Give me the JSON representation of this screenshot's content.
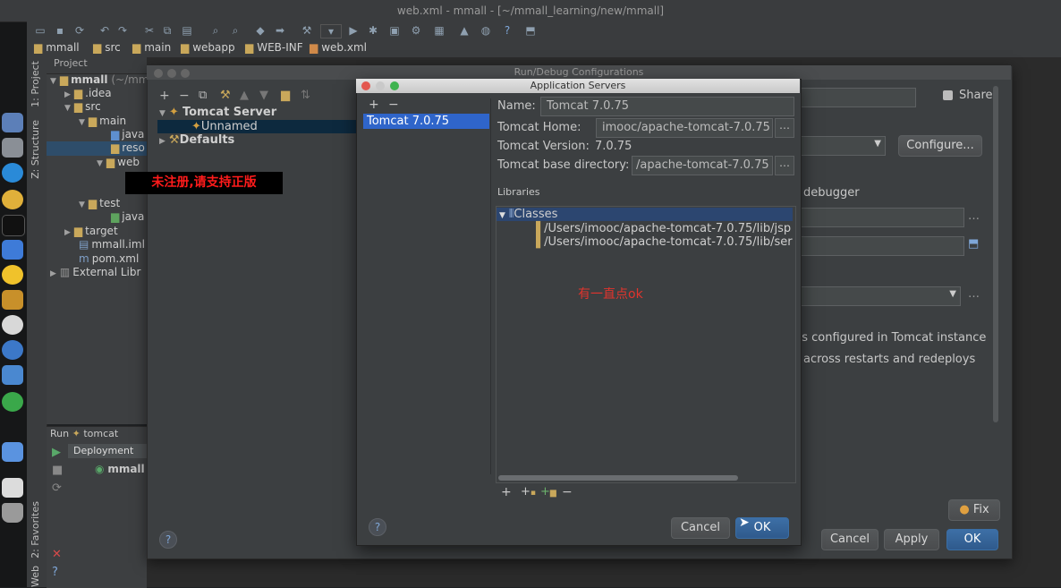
{
  "window": {
    "title": "web.xml - mmall - [~/mmall_learning/new/mmall]"
  },
  "breadcrumb": [
    "mmall",
    "src",
    "main",
    "webapp",
    "WEB-INF",
    "web.xml"
  ],
  "side_tabs": {
    "project": "1: Project",
    "structure": "Z: Structure",
    "favorites": "2: Favorites",
    "web": "Web"
  },
  "project_panel": {
    "header": "Project",
    "tree": [
      {
        "label": "mmall",
        "suffix": "(~/mm"
      },
      {
        "label": ".idea"
      },
      {
        "label": "src"
      },
      {
        "label": "main"
      },
      {
        "label": "java"
      },
      {
        "label": "reso"
      },
      {
        "label": "web"
      },
      {
        "label": "test"
      },
      {
        "label": "java"
      },
      {
        "label": "target"
      },
      {
        "label": "mmall.iml"
      },
      {
        "label": "pom.xml"
      },
      {
        "label": "External Libr"
      }
    ]
  },
  "run_panel": {
    "label": "Run",
    "config": "tomcat",
    "tab": "Deployment",
    "item": "mmall"
  },
  "config_dialog": {
    "title": "Run/Debug Configurations",
    "tree_root": "Tomcat Server",
    "tree_child": "Unnamed",
    "tree_defaults": "Defaults",
    "share_label": "Share",
    "configure_button": "Configure...",
    "debugger_text": "debugger",
    "configured_text": "ns configured in Tomcat instance",
    "restarts_text": "across restarts and redeploys",
    "fix_button": "Fix",
    "cancel_button": "Cancel",
    "apply_button": "Apply",
    "ok_button": "OK"
  },
  "app_servers_dialog": {
    "title": "Application Servers",
    "servers": [
      "Tomcat 7.0.75"
    ],
    "name_label": "Name:",
    "name_value": "Tomcat 7.0.75",
    "home_label": "Tomcat Home:",
    "home_value": "imooc/apache-tomcat-7.0.75",
    "version_label": "Tomcat Version:",
    "version_value": "7.0.75",
    "base_label": "Tomcat base directory:",
    "base_value": "/apache-tomcat-7.0.75",
    "libraries_label": "Libraries",
    "classes_label": "Classes",
    "libs": [
      "/Users/imooc/apache-tomcat-7.0.75/lib/jsp",
      "/Users/imooc/apache-tomcat-7.0.75/lib/ser"
    ],
    "cancel_button": "Cancel",
    "ok_button": "OK"
  },
  "overlays": {
    "watermark": "未注册,请支持正版",
    "note": "有一直点ok"
  },
  "colors": {
    "selection": "#2f65ca",
    "ok_blue": "#2f5a8c",
    "watermark_red": "#ff1b1b"
  }
}
